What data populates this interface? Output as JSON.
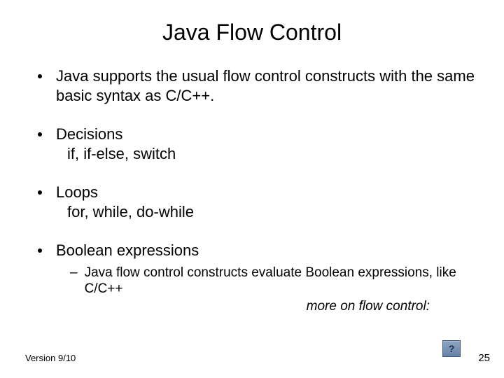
{
  "title": "Java Flow Control",
  "bullets": {
    "b0": "Java supports the usual flow control constructs with the same basic syntax as C/C++.",
    "b1": "Decisions",
    "b1_sub": "if, if-else, switch",
    "b2": "Loops",
    "b2_sub": "for, while, do-while",
    "b3": "Boolean expressions",
    "b3_sub": "Java flow control constructs evaluate Boolean expressions, like C/C++"
  },
  "more_note": "more on flow control:",
  "help_icon": "?",
  "footer": {
    "version": "Version 9/10",
    "page": "25"
  }
}
